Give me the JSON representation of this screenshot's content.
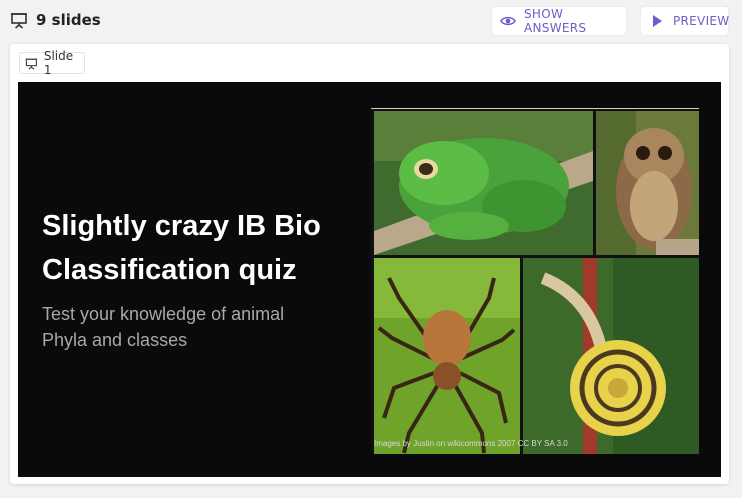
{
  "header": {
    "slide_count": "9 slides",
    "icons": {
      "slides": "presentation-icon",
      "show_answers": "eye-icon",
      "preview": "play-icon"
    },
    "show_answers_label": "SHOW ANSWERS",
    "preview_label": "PREVIEW"
  },
  "slide_chip": {
    "label": "Slide 1",
    "icon": "presentation-icon"
  },
  "slide": {
    "title_line1": "Slightly crazy IB Bio",
    "title_line2": "Classification quiz",
    "subtitle_line1": "Test your knowledge of animal",
    "subtitle_line2": "Phyla and classes",
    "image_credit": "Images by Justin on wikicommons 2007 CC BY SA 3.0",
    "images": [
      "frog",
      "owl",
      "spider",
      "snail"
    ]
  },
  "colors": {
    "accent": "#6c5fc7",
    "slide_bg": "#0a0a0a",
    "page_bg": "#f2f2f2"
  }
}
